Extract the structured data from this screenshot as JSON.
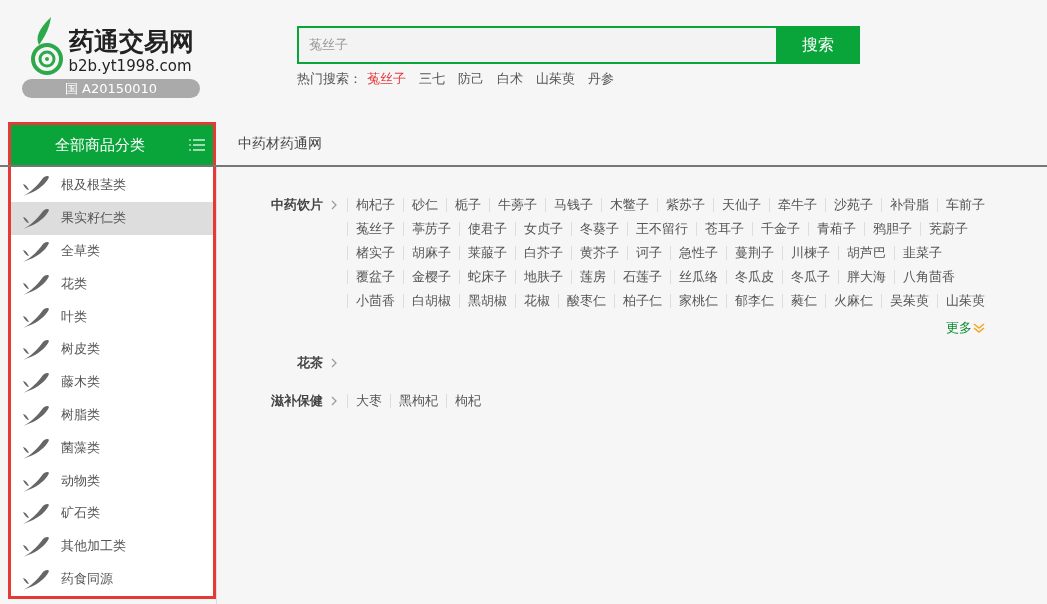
{
  "logo": {
    "name": "药通交易网",
    "domain": "b2b.yt1998.com",
    "license": "国 A20150010"
  },
  "search": {
    "value": "菟丝子",
    "button": "搜索"
  },
  "hot_search": {
    "label": "热门搜索：",
    "terms": [
      {
        "text": "菟丝子",
        "highlighted": true
      },
      {
        "text": "三七",
        "highlighted": false
      },
      {
        "text": "防己",
        "highlighted": false
      },
      {
        "text": "白术",
        "highlighted": false
      },
      {
        "text": "山茱萸",
        "highlighted": false
      },
      {
        "text": "丹参",
        "highlighted": false
      }
    ]
  },
  "nav": {
    "category_tab": "全部商品分类",
    "links": [
      "中药材药通网"
    ]
  },
  "sidebar": {
    "items": [
      {
        "label": "根及根茎类",
        "selected": false
      },
      {
        "label": "果实籽仁类",
        "selected": true
      },
      {
        "label": "全草类",
        "selected": false
      },
      {
        "label": "花类",
        "selected": false
      },
      {
        "label": "叶类",
        "selected": false
      },
      {
        "label": "树皮类",
        "selected": false
      },
      {
        "label": "藤木类",
        "selected": false
      },
      {
        "label": "树脂类",
        "selected": false
      },
      {
        "label": "菌藻类",
        "selected": false
      },
      {
        "label": "动物类",
        "selected": false
      },
      {
        "label": "矿石类",
        "selected": false
      },
      {
        "label": "其他加工类",
        "selected": false
      },
      {
        "label": "药食同源",
        "selected": false
      }
    ]
  },
  "sections": [
    {
      "title": "中药饮片",
      "rows": [
        [
          "枸杞子",
          "砂仁",
          "栀子",
          "牛蒡子",
          "马钱子",
          "木鳖子",
          "紫苏子",
          "天仙子",
          "牵牛子",
          "沙苑子",
          "补骨脂",
          "车前子"
        ],
        [
          "菟丝子",
          "葶苈子",
          "使君子",
          "女贞子",
          "冬葵子",
          "王不留行",
          "苍耳子",
          "千金子",
          "青葙子",
          "鸦胆子",
          "茺蔚子"
        ],
        [
          "楮实子",
          "胡麻子",
          "莱菔子",
          "白芥子",
          "黄芥子",
          "诃子",
          "急性子",
          "蔓荆子",
          "川楝子",
          "胡芦巴",
          "韭菜子"
        ],
        [
          "覆盆子",
          "金樱子",
          "蛇床子",
          "地肤子",
          "莲房",
          "石莲子",
          "丝瓜络",
          "冬瓜皮",
          "冬瓜子",
          "胖大海",
          "八角茴香"
        ],
        [
          "小茴香",
          "白胡椒",
          "黑胡椒",
          "花椒",
          "酸枣仁",
          "柏子仁",
          "家桃仁",
          "郁李仁",
          "蕤仁",
          "火麻仁",
          "吴茱萸",
          "山茱萸"
        ]
      ],
      "more": "更多"
    },
    {
      "title": "花茶"
    },
    {
      "title": "滋补保健",
      "rows": [
        [
          "大枣",
          "黑枸杞",
          "枸杞"
        ]
      ]
    }
  ]
}
